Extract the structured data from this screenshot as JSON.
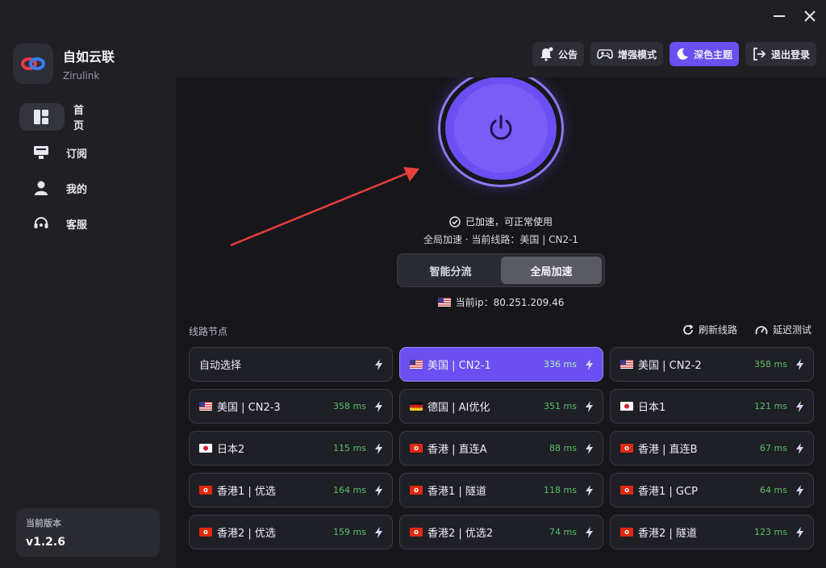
{
  "window": {
    "minimize_icon": "minimize-icon",
    "close_icon": "close-icon"
  },
  "brand": {
    "name": "自如云联",
    "subtitle": "Zirulink"
  },
  "nav": [
    {
      "label": "首页",
      "icon": "dashboard-icon",
      "active": true
    },
    {
      "label": "订阅",
      "icon": "subscription-icon"
    },
    {
      "label": "我的",
      "icon": "user-icon"
    },
    {
      "label": "客服",
      "icon": "headset-icon"
    }
  ],
  "version": {
    "label": "当前版本",
    "value": "v1.2.6"
  },
  "topbar": {
    "announce": "公告",
    "enhanced": "增强模式",
    "theme": "深色主题",
    "logout": "退出登录"
  },
  "status": {
    "connected": "已加速，可正常使用",
    "detail": "全局加速 · 当前线路：美国 | CN2-1",
    "ip": "当前ip：80.251.209.46"
  },
  "mode": {
    "smart": "智能分流",
    "global": "全局加速",
    "selected": "global"
  },
  "section": {
    "title": "线路节点",
    "refresh": "刷新线路",
    "latency_test": "延迟测试"
  },
  "nodes": [
    {
      "name": "自动选择",
      "latency": "",
      "flag": "none"
    },
    {
      "name": "美国 | CN2-1",
      "latency": "336 ms",
      "flag": "us",
      "active": true
    },
    {
      "name": "美国 | CN2-2",
      "latency": "358 ms",
      "flag": "us"
    },
    {
      "name": "美国 | CN2-3",
      "latency": "358 ms",
      "flag": "us"
    },
    {
      "name": "德国 | AI优化",
      "latency": "351 ms",
      "flag": "de"
    },
    {
      "name": "日本1",
      "latency": "121 ms",
      "flag": "jp"
    },
    {
      "name": "日本2",
      "latency": "115 ms",
      "flag": "jp"
    },
    {
      "name": "香港 | 直连A",
      "latency": "88 ms",
      "flag": "hk"
    },
    {
      "name": "香港 | 直连B",
      "latency": "67 ms",
      "flag": "hk"
    },
    {
      "name": "香港1 | 优选",
      "latency": "164 ms",
      "flag": "hk"
    },
    {
      "name": "香港1 | 隧道",
      "latency": "118 ms",
      "flag": "hk"
    },
    {
      "name": "香港1 | GCP",
      "latency": "64 ms",
      "flag": "hk"
    },
    {
      "name": "香港2 | 优选",
      "latency": "159 ms",
      "flag": "hk"
    },
    {
      "name": "香港2 | 优选2",
      "latency": "74 ms",
      "flag": "hk"
    },
    {
      "name": "香港2 | 隧道",
      "latency": "123 ms",
      "flag": "hk"
    }
  ],
  "colors": {
    "accent": "#6b4ff0",
    "latency": "#59c26a",
    "arrow": "#e8403e"
  }
}
